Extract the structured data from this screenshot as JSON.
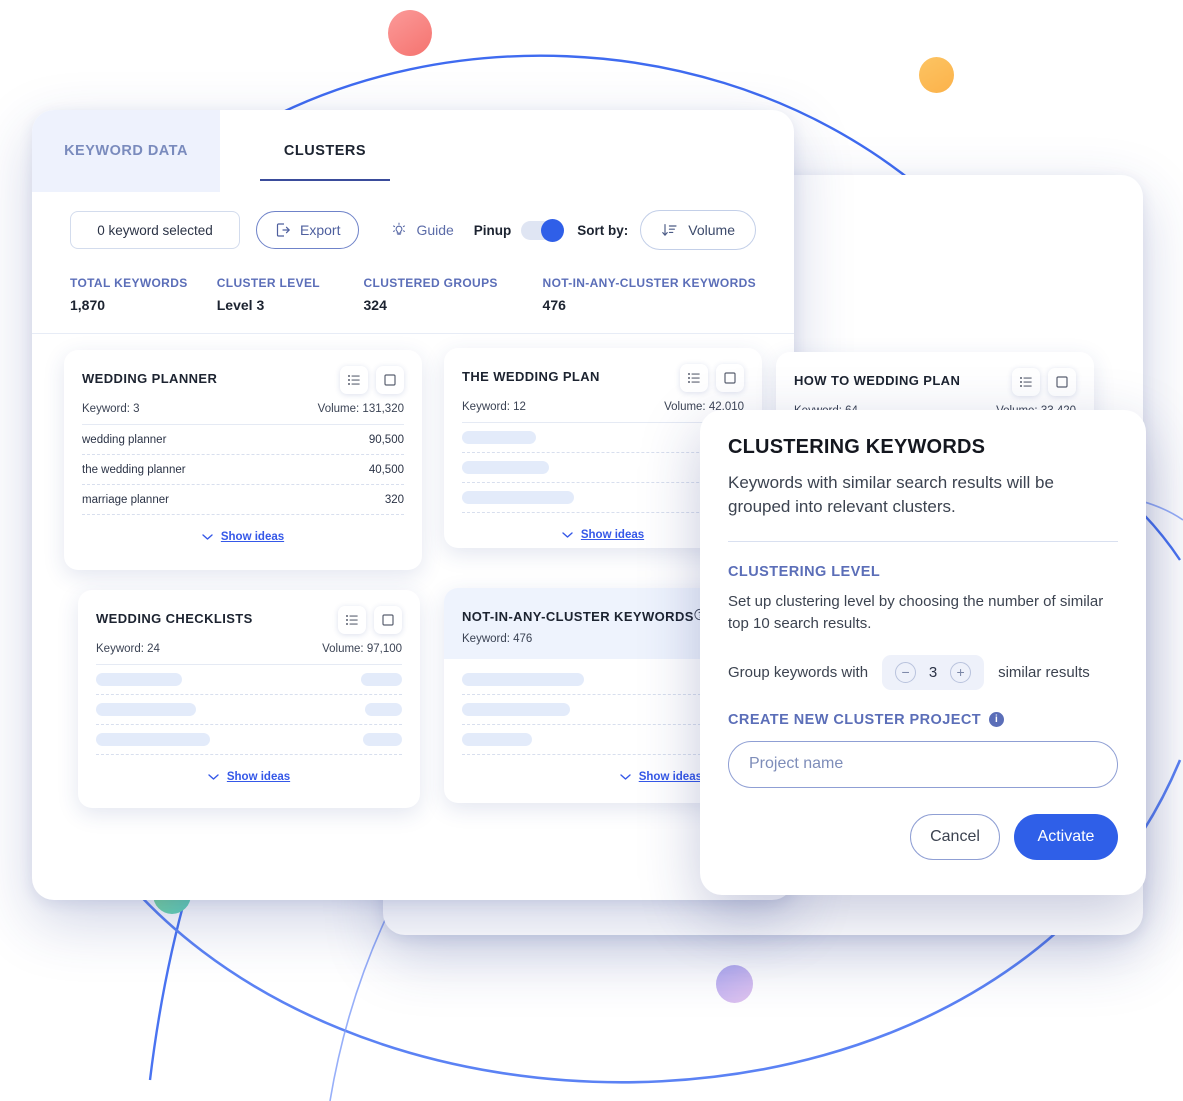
{
  "tabs": [
    {
      "label": "KEYWORD DATA",
      "active": false
    },
    {
      "label": "CLUSTERS",
      "active": true
    }
  ],
  "toolbar": {
    "keyword_selected": "0 keyword selected",
    "export_label": "Export",
    "guide_label": "Guide",
    "pinup_label": "Pinup",
    "sort_by_label": "Sort by:",
    "sort_value": "Volume"
  },
  "stats": [
    {
      "label": "TOTAL KEYWORDS",
      "value": "1,870"
    },
    {
      "label": "CLUSTER LEVEL",
      "value": "Level 3"
    },
    {
      "label": "CLUSTERED GROUPS",
      "value": "324"
    },
    {
      "label": "NOT-IN-ANY-CLUSTER KEYWORDS",
      "value": "476"
    }
  ],
  "show_ideas_label": "Show ideas",
  "cards": [
    {
      "title": "WEDDING PLANNER",
      "keyword_label": "Keyword: 3",
      "volume_label": "Volume: 131,320",
      "keywords": [
        {
          "term": "wedding planner",
          "volume": "90,500"
        },
        {
          "term": "the wedding planner",
          "volume": "40,500"
        },
        {
          "term": "marriage planner",
          "volume": "320"
        }
      ]
    },
    {
      "title": "THE WEDDING PLAN",
      "keyword_label": "Keyword: 12",
      "volume_label": "Volume: 42,010",
      "keywords": []
    },
    {
      "title": "HOW TO WEDDING PLAN",
      "keyword_label": "Keyword: 64",
      "volume_label": "Volume: 33,420",
      "keywords": []
    },
    {
      "title": "WEDDING CHECKLISTS",
      "keyword_label": "Keyword: 24",
      "volume_label": "Volume: 97,100",
      "keywords": []
    },
    {
      "title": "NOT-IN-ANY-CLUSTER KEYWORDS",
      "keyword_label": "Keyword: 476",
      "volume_label": "",
      "keywords": []
    }
  ],
  "modal": {
    "title": "CLUSTERING KEYWORDS",
    "description": "Keywords with similar search results will be grouped into relevant clusters.",
    "section_title": "CLUSTERING LEVEL",
    "section_description": "Set up clustering level by choosing the number of similar top 10 search results.",
    "stepper_prefix": "Group keywords with",
    "stepper_value": "3",
    "stepper_suffix": "similar results",
    "minus_label": "−",
    "plus_label": "+",
    "create_project_label": "CREATE NEW CLUSTER PROJECT",
    "info_glyph": "i",
    "project_name_placeholder": "Project name",
    "cancel_label": "Cancel",
    "activate_label": "Activate"
  },
  "colors": {
    "accent_blue": "#2f5fe8",
    "link_blue": "#3558e8",
    "label_blue": "#5b6eb8",
    "tab_inactive_bg": "#eef2fd",
    "dot_red": "#f5736f",
    "dot_orange": "#fbb24a",
    "dot_green": "#5fd4c0",
    "dot_purple": "#b3aef3",
    "curve_blue": "#3f6bf0"
  },
  "icons": {
    "export": "export-icon",
    "guide": "lightbulb-icon",
    "sort": "sort-descending-icon",
    "card_list": "list-icon",
    "card_checkbox": "checkbox-icon",
    "chevron": "chevron-down-icon",
    "help": "help-circle-icon"
  }
}
